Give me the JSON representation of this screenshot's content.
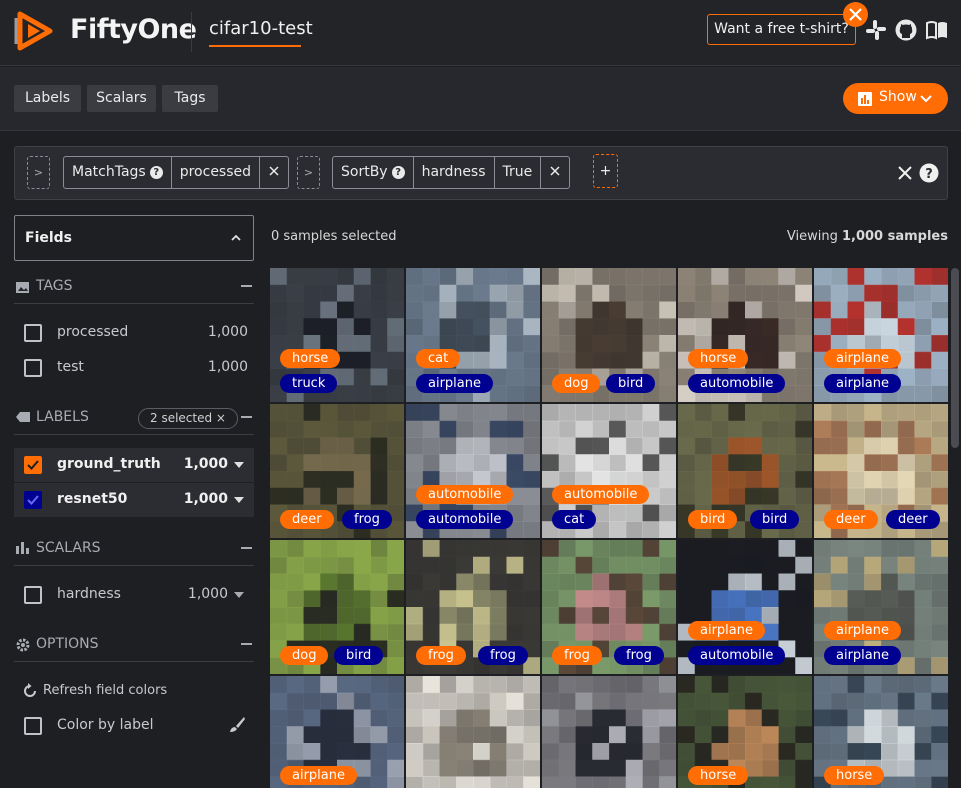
{
  "header": {
    "app_name": "FiftyOne",
    "dataset": "cifar10-test",
    "tshirt_label": "Want a free t-shirt?",
    "accent": "#ff6d04"
  },
  "toolbar": {
    "tabs": [
      "Labels",
      "Scalars",
      "Tags"
    ],
    "show_label": "Show"
  },
  "view_bar": {
    "stages": [
      {
        "name": "MatchTags",
        "params": [
          "processed"
        ]
      },
      {
        "name": "SortBy",
        "params": [
          "hardness",
          "True"
        ]
      }
    ],
    "add_symbol": "+"
  },
  "sidebar": {
    "fields_label": "Fields",
    "tags": {
      "title": "TAGS",
      "items": [
        {
          "name": "processed",
          "count": "1,000"
        },
        {
          "name": "test",
          "count": "1,000"
        }
      ]
    },
    "labels": {
      "title": "LABELS",
      "badge": "2 selected ×",
      "items": [
        {
          "name": "ground_truth",
          "count": "1,000",
          "color": "#ff6d04"
        },
        {
          "name": "resnet50",
          "count": "1,000",
          "color": "#000091"
        }
      ]
    },
    "scalars": {
      "title": "SCALARS",
      "items": [
        {
          "name": "hardness",
          "count": "1,000"
        }
      ]
    },
    "options": {
      "title": "OPTIONS",
      "refresh": "Refresh field colors",
      "color_by_label": "Color by label"
    }
  },
  "main": {
    "selected": "0 samples selected",
    "viewing_prefix": "Viewing ",
    "viewing_count": "1,000 samples",
    "samples": [
      {
        "gt": "horse",
        "pred": "truck"
      },
      {
        "gt": "cat",
        "pred": "airplane"
      },
      {
        "gt": "dog",
        "pred": "bird"
      },
      {
        "gt": "horse",
        "pred": "automobile"
      },
      {
        "gt": "airplane",
        "pred": "airplane"
      },
      {
        "gt": "deer",
        "pred": "frog"
      },
      {
        "gt": "automobile",
        "pred": "automobile"
      },
      {
        "gt": "automobile",
        "pred": "cat"
      },
      {
        "gt": "bird",
        "pred": "bird"
      },
      {
        "gt": "deer",
        "pred": "deer"
      },
      {
        "gt": "dog",
        "pred": "bird"
      },
      {
        "gt": "frog",
        "pred": "frog"
      },
      {
        "gt": "frog",
        "pred": "frog"
      },
      {
        "gt": "airplane",
        "pred": "automobile"
      },
      {
        "gt": "airplane",
        "pred": "airplane"
      },
      {
        "gt": "airplane",
        "pred": ""
      },
      {
        "gt": "",
        "pred": ""
      },
      {
        "gt": "",
        "pred": ""
      },
      {
        "gt": "horse",
        "pred": ""
      },
      {
        "gt": "horse",
        "pred": ""
      }
    ]
  }
}
